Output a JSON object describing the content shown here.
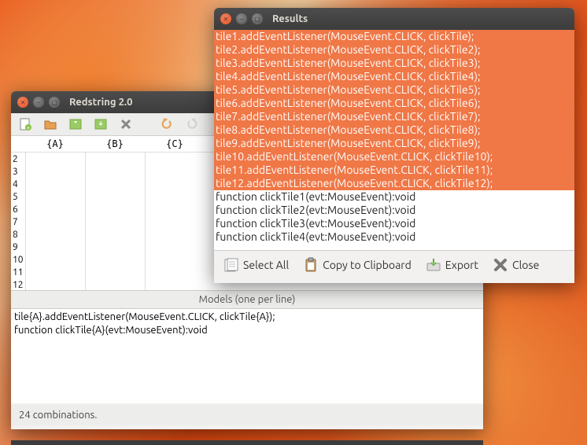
{
  "redstring": {
    "title": "Redstring 2.0",
    "columns": [
      "{A}",
      "{B}",
      "{C}"
    ],
    "line_numbers": [
      "2",
      "3",
      "4",
      "5",
      "6",
      "7",
      "8",
      "9",
      "10",
      "11",
      "12"
    ],
    "models_header": "Models (one per line)",
    "models": [
      "tile{A}.addEventListener(MouseEvent.CLICK, clickTile{A});",
      "function clickTile{A}(evt:MouseEvent):void"
    ],
    "status": "24 combinations."
  },
  "results": {
    "title": "Results",
    "highlighted": [
      "tile1.addEventListener(MouseEvent.CLICK, clickTile);",
      "tile2.addEventListener(MouseEvent.CLICK, clickTile2);",
      "tile3.addEventListener(MouseEvent.CLICK, clickTile3);",
      "tile4.addEventListener(MouseEvent.CLICK, clickTile4);",
      "tile5.addEventListener(MouseEvent.CLICK, clickTile5);",
      "tile6.addEventListener(MouseEvent.CLICK, clickTile6);",
      "tile7.addEventListener(MouseEvent.CLICK, clickTile7);",
      "tile8.addEventListener(MouseEvent.CLICK, clickTile8);",
      "tile9.addEventListener(MouseEvent.CLICK, clickTile9);",
      "tile10.addEventListener(MouseEvent.CLICK, clickTile10);",
      "tile11.addEventListener(MouseEvent.CLICK, clickTile11);",
      "tile12.addEventListener(MouseEvent.CLICK, clickTile12);"
    ],
    "normal": [
      "function clickTile1(evt:MouseEvent):void",
      "function clickTile2(evt:MouseEvent):void",
      "function clickTile3(evt:MouseEvent):void",
      "function clickTile4(evt:MouseEvent):void"
    ],
    "toolbar": {
      "select_all": "Select All",
      "copy": "Copy to Clipboard",
      "export": "Export",
      "close": "Close"
    }
  }
}
